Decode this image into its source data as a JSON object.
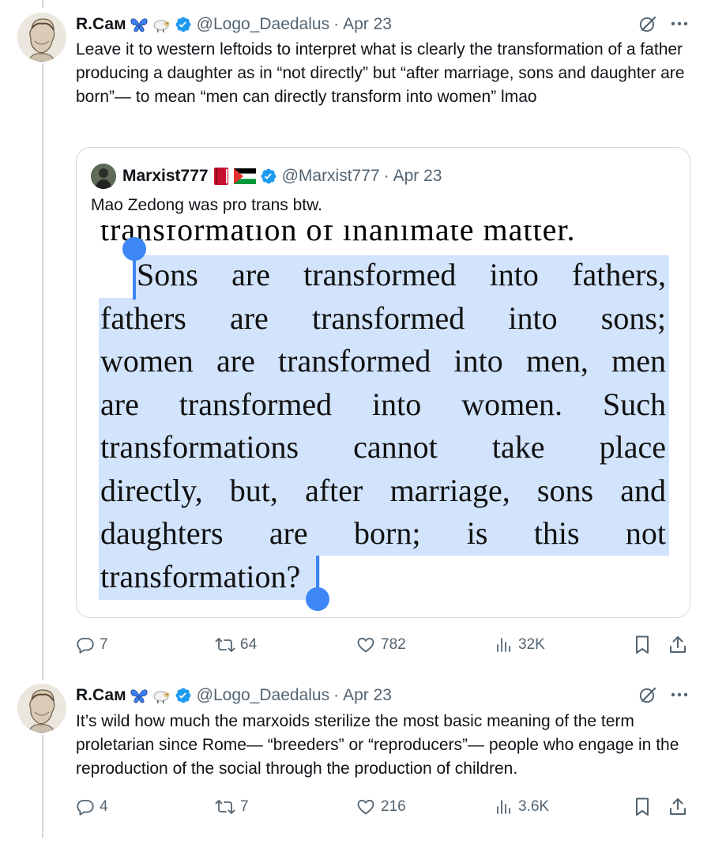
{
  "tweets": [
    {
      "name": "R.Сам",
      "handle": "@Logo_Daedalus",
      "date": "Apr 23",
      "text": "Leave it to western leftoids to interpret what is clearly the transformation of a father producing a daughter as in “not directly” but “after marriage, sons and daughter are born”— to mean “men can directly transform into women” lmao",
      "replies": "7",
      "reposts": "64",
      "likes": "782",
      "views": "32K"
    },
    {
      "name": "R.Сам",
      "handle": "@Logo_Daedalus",
      "date": "Apr 23",
      "text": "It’s wild how much the marxoids sterilize the most basic meaning of the term proletarian since Rome— “breeders” or “reproducers”— people who engage in the reproduction of the social through the production of children.",
      "replies": "4",
      "reposts": "7",
      "likes": "216",
      "views": "3.6K"
    }
  ],
  "quote": {
    "name": "Marxist777",
    "handle": "@Marxist777",
    "date": "Apr 23",
    "text": "Mao Zedong was pro trans btw.",
    "image_text": {
      "cut_line": "transformation of inanimate matter.",
      "lines": [
        "Sons are transformed into fathers,",
        "fathers are transformed into sons;",
        "women are transformed into men, men",
        "are transformed into women. Such",
        "transformations cannot take place",
        "directly, but, after marriage, sons and",
        "daughters are born; is this not",
        "transformation?"
      ]
    }
  },
  "separator": "·",
  "colors": {
    "verified": "#1d9bf0",
    "selection": "#d2e3fc",
    "handle": "#3d86f5",
    "secondary_text": "#536471"
  },
  "icons": [
    "butterfly-icon",
    "sheep-icon",
    "verified-badge-icon",
    "grok-icon",
    "more-icon",
    "red-book-icon",
    "palestine-flag-icon",
    "reply-icon",
    "repost-icon",
    "like-icon",
    "views-icon",
    "bookmark-icon",
    "share-icon"
  ]
}
